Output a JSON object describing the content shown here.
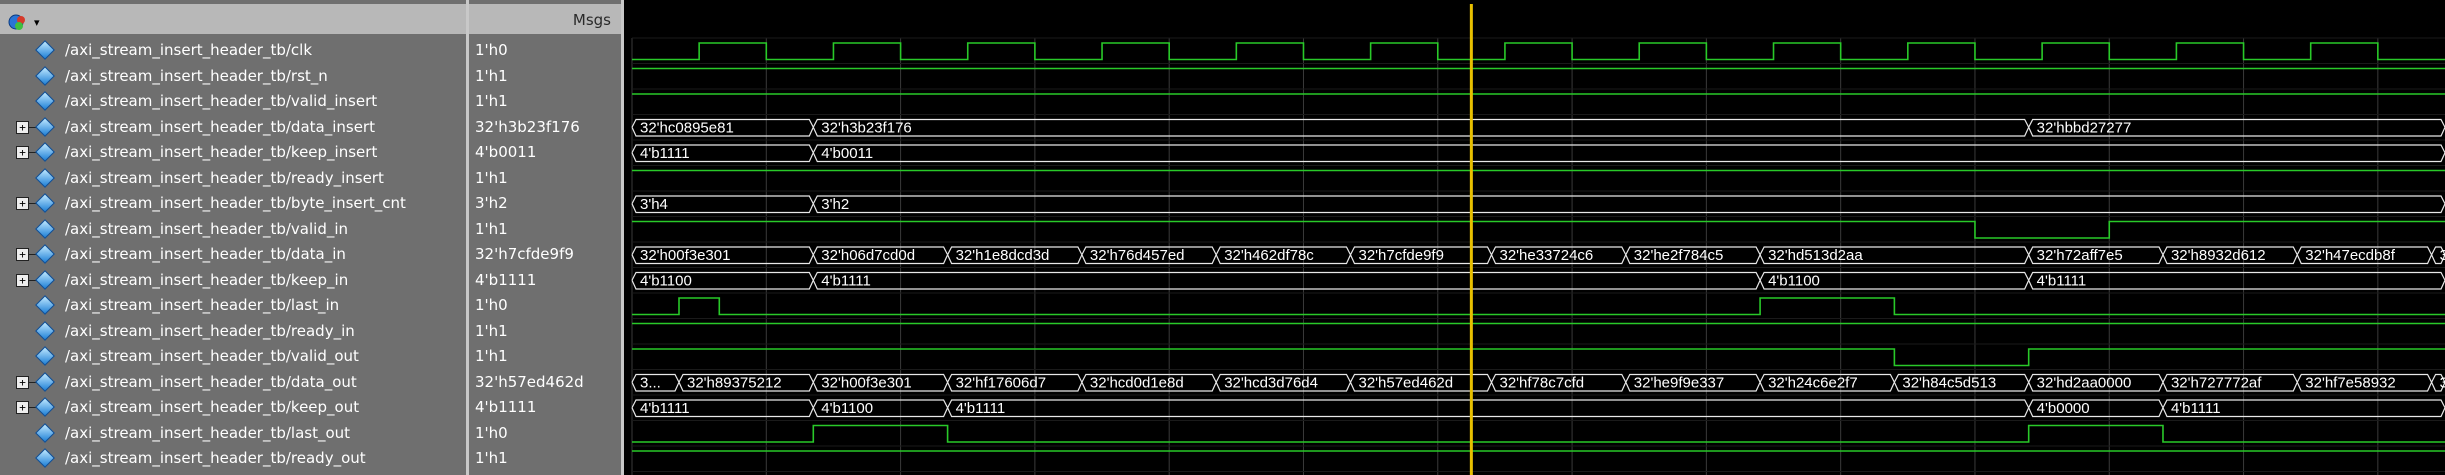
{
  "header": {
    "msgs": "Msgs"
  },
  "colors": {
    "wave": "#29c929",
    "bus": "#e8e8e8",
    "cursor": "#e8c000",
    "grid": "#3a3a3a"
  },
  "signals": [
    {
      "name": "/axi_stream_insert_header_tb/clk",
      "value": "1'h0",
      "bus": false
    },
    {
      "name": "/axi_stream_insert_header_tb/rst_n",
      "value": "1'h1",
      "bus": false
    },
    {
      "name": "/axi_stream_insert_header_tb/valid_insert",
      "value": "1'h1",
      "bus": false
    },
    {
      "name": "/axi_stream_insert_header_tb/data_insert",
      "value": "32'h3b23f176",
      "bus": true
    },
    {
      "name": "/axi_stream_insert_header_tb/keep_insert",
      "value": "4'b0011",
      "bus": true
    },
    {
      "name": "/axi_stream_insert_header_tb/ready_insert",
      "value": "1'h1",
      "bus": false
    },
    {
      "name": "/axi_stream_insert_header_tb/byte_insert_cnt",
      "value": "3'h2",
      "bus": true
    },
    {
      "name": "/axi_stream_insert_header_tb/valid_in",
      "value": "1'h1",
      "bus": false
    },
    {
      "name": "/axi_stream_insert_header_tb/data_in",
      "value": "32'h7cfde9f9",
      "bus": true
    },
    {
      "name": "/axi_stream_insert_header_tb/keep_in",
      "value": "4'b1111",
      "bus": true
    },
    {
      "name": "/axi_stream_insert_header_tb/last_in",
      "value": "1'h0",
      "bus": false
    },
    {
      "name": "/axi_stream_insert_header_tb/ready_in",
      "value": "1'h1",
      "bus": false
    },
    {
      "name": "/axi_stream_insert_header_tb/valid_out",
      "value": "1'h1",
      "bus": false
    },
    {
      "name": "/axi_stream_insert_header_tb/data_out",
      "value": "32'h57ed462d",
      "bus": true
    },
    {
      "name": "/axi_stream_insert_header_tb/keep_out",
      "value": "4'b1111",
      "bus": true
    },
    {
      "name": "/axi_stream_insert_header_tb/last_out",
      "value": "1'h0",
      "bus": false
    },
    {
      "name": "/axi_stream_insert_header_tb/ready_out",
      "value": "1'h1",
      "bus": false
    }
  ],
  "waves": {
    "start": 0,
    "end": 13.5,
    "clk_period": 1,
    "cursor_time": 6.25,
    "bits": {
      "0": {
        "clock": true
      },
      "1": {
        "init": 1,
        "toggles": []
      },
      "2": {
        "init": 1,
        "toggles": []
      },
      "5": {
        "init": 1,
        "toggles": []
      },
      "7": {
        "init": 1,
        "toggles": [
          10,
          11
        ]
      },
      "10": {
        "init": 0,
        "toggles": [
          0.35,
          0.65,
          8.4,
          9.4
        ]
      },
      "11": {
        "init": 1,
        "toggles": []
      },
      "12": {
        "init": 1,
        "toggles": [
          9.4,
          10.4
        ]
      },
      "15": {
        "init": 0,
        "toggles": [
          1.35,
          2.35,
          10.4,
          11.4
        ]
      },
      "16": {
        "init": 1,
        "toggles": []
      }
    },
    "buses": {
      "3": [
        [
          0,
          "32'hc0895e81"
        ],
        [
          1.35,
          "32'h3b23f176"
        ],
        [
          10.4,
          "32'hbbd27277"
        ]
      ],
      "4": [
        [
          0,
          "4'b1111"
        ],
        [
          1.35,
          "4'b0011"
        ]
      ],
      "6": [
        [
          0,
          "3'h4"
        ],
        [
          1.35,
          "3'h2"
        ]
      ],
      "8": [
        [
          0,
          "32'h00f3e301"
        ],
        [
          1.35,
          "32'h06d7cd0d"
        ],
        [
          2.35,
          "32'h1e8dcd3d"
        ],
        [
          3.35,
          "32'h76d457ed"
        ],
        [
          4.35,
          "32'h462df78c"
        ],
        [
          5.35,
          "32'h7cfde9f9"
        ],
        [
          6.4,
          "32'he33724c6"
        ],
        [
          7.4,
          "32'he2f784c5"
        ],
        [
          8.4,
          "32'hd513d2aa"
        ],
        [
          10.4,
          "32'h72aff7e5"
        ],
        [
          11.4,
          "32'h8932d612"
        ],
        [
          12.4,
          "32'h47ecdb8f"
        ],
        [
          13.4,
          "3"
        ]
      ],
      "9": [
        [
          0,
          "4'b1100"
        ],
        [
          1.35,
          "4'b1111"
        ],
        [
          8.4,
          "4'b1100"
        ],
        [
          10.4,
          "4'b1111"
        ]
      ],
      "13": [
        [
          0,
          "3..."
        ],
        [
          0.35,
          "32'h89375212"
        ],
        [
          1.35,
          "32'h00f3e301"
        ],
        [
          2.35,
          "32'hf17606d7"
        ],
        [
          3.35,
          "32'hcd0d1e8d"
        ],
        [
          4.35,
          "32'hcd3d76d4"
        ],
        [
          5.35,
          "32'h57ed462d"
        ],
        [
          6.4,
          "32'hf78c7cfd"
        ],
        [
          7.4,
          "32'he9f9e337"
        ],
        [
          8.4,
          "32'h24c6e2f7"
        ],
        [
          9.4,
          "32'h84c5d513"
        ],
        [
          10.4,
          "32'hd2aa0000"
        ],
        [
          11.4,
          "32'h727772af"
        ],
        [
          12.4,
          "32'hf7e58932"
        ],
        [
          13.4,
          "3"
        ]
      ],
      "14": [
        [
          0,
          "4'b1111"
        ],
        [
          1.35,
          "4'b1100"
        ],
        [
          2.35,
          "4'b1111"
        ],
        [
          10.4,
          "4'b0000"
        ],
        [
          11.4,
          "4'b1111"
        ]
      ]
    }
  }
}
